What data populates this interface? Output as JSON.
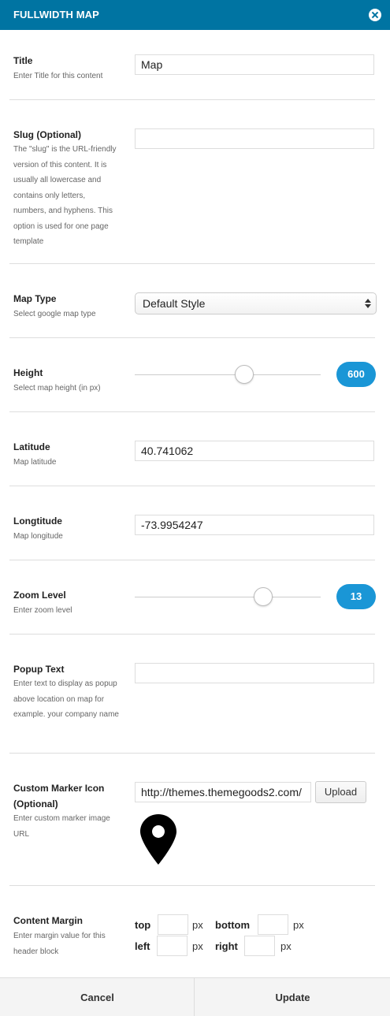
{
  "header": {
    "title": "FULLWIDTH MAP",
    "accent": "#0074a2"
  },
  "fields": {
    "title": {
      "label": "Title",
      "desc": "Enter Title for this content",
      "value": "Map"
    },
    "slug": {
      "label": "Slug (Optional)",
      "desc": "The \"slug\" is the URL-friendly version of this content. It is usually all lowercase and contains only letters, numbers, and hyphens. This option is used for one page template",
      "value": ""
    },
    "map_type": {
      "label": "Map Type",
      "desc": "Select google map type",
      "value": "Default Style"
    },
    "height": {
      "label": "Height",
      "desc": "Select map height (in px)",
      "value": "600",
      "slider_fraction": 0.59
    },
    "latitude": {
      "label": "Latitude",
      "desc": "Map latitude",
      "value": "40.741062"
    },
    "longtitude": {
      "label": "Longtitude",
      "desc": "Map longitude",
      "value": "-73.9954247"
    },
    "zoom": {
      "label": "Zoom Level",
      "desc": "Enter zoom level",
      "value": "13",
      "slider_fraction": 0.69
    },
    "popup": {
      "label": "Popup Text",
      "desc": "Enter text to display as popup above location on map for example. your company name",
      "value": ""
    },
    "marker": {
      "label": "Custom Marker Icon (Optional)",
      "desc": "Enter custom marker image URL",
      "value": "http://themes.themegoods2.com/",
      "upload_label": "Upload",
      "preview_icon": "map-marker-icon"
    },
    "margin": {
      "label": "Content Margin",
      "desc": "Enter margin value for this header block",
      "top_label": "top",
      "bottom_label": "bottom",
      "left_label": "left",
      "right_label": "right",
      "unit": "px"
    }
  },
  "footer": {
    "cancel_label": "Cancel",
    "update_label": "Update"
  },
  "colors": {
    "badge": "#1a96d6"
  }
}
